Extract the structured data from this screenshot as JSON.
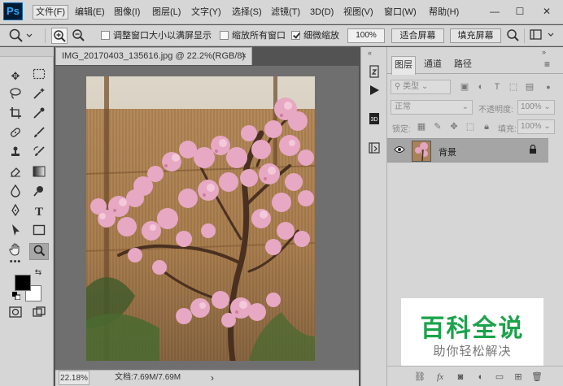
{
  "app": {
    "logo": "Ps"
  },
  "menu": {
    "items": [
      "文件(F)",
      "编辑(E)",
      "图像(I)",
      "图层(L)",
      "文字(Y)",
      "选择(S)",
      "滤镜(T)",
      "3D(D)",
      "视图(V)",
      "窗口(W)",
      "帮助(H)"
    ],
    "active_index": 0
  },
  "window_controls": {
    "minimize": "—",
    "maximize": "☐",
    "close": "✕"
  },
  "options": {
    "resize_windows_label": "调整窗口大小以满屏显示",
    "resize_windows_checked": false,
    "zoom_all_label": "缩放所有窗口",
    "zoom_all_checked": false,
    "scrubby_zoom_label": "细微缩放",
    "scrubby_zoom_checked": true,
    "zoom_value": "100%",
    "fit_screen_label": "适合屏幕",
    "fill_screen_label": "填充屏幕"
  },
  "document": {
    "tab_title": "IMG_20170403_135616.jpg @ 22.2%(RGB/8)",
    "tab_close": "×"
  },
  "status": {
    "zoom": "22.18%",
    "doc_info": "文档:7.69M/7.69M",
    "arrow": "›"
  },
  "layers_panel": {
    "tabs": [
      "图层",
      "通道",
      "路径"
    ],
    "active_tab": 0,
    "filter_kind": "类型",
    "blend_mode": "正常",
    "opacity_label": "不透明度:",
    "opacity_value": "100%",
    "lock_label": "锁定:",
    "fill_label": "填充:",
    "fill_value": "100%",
    "layers": [
      {
        "name": "背景",
        "visible": true,
        "locked": true
      }
    ]
  },
  "watermark": {
    "title": "百科全说",
    "subtitle": "助你轻松解决"
  },
  "colors": {
    "foreground": "#000000",
    "background": "#ffffff"
  }
}
